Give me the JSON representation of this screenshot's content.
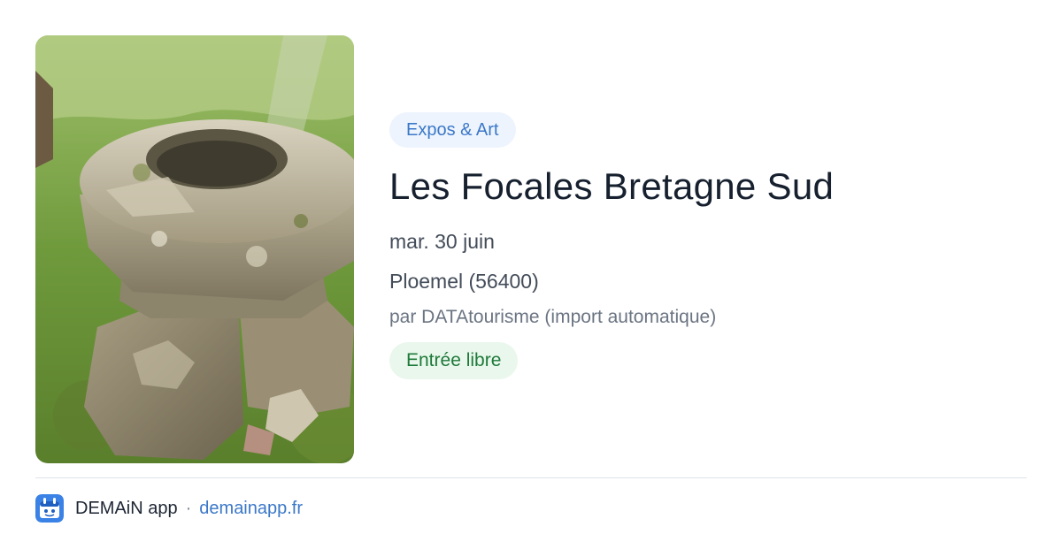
{
  "image": {
    "alt": "Les Focales Bretagne Sud",
    "icon": "stone-font-photo"
  },
  "event": {
    "category": "Expos & Art",
    "title": "Les Focales Bretagne Sud",
    "date": "mar. 30 juin",
    "location": "Ploemel (56400)",
    "author": "par DATAtourisme (import automatique)",
    "price": "Entrée libre"
  },
  "footer": {
    "app_name": "DEMAiN app",
    "separator": "·",
    "domain": "demainapp.fr",
    "icon": "demain-app-icon"
  },
  "colors": {
    "accent": "#3b78c8",
    "category_bg": "#eef4fd",
    "price_bg": "#eaf7ed",
    "price_text": "#1e7a3a",
    "title_text": "#16202e"
  }
}
